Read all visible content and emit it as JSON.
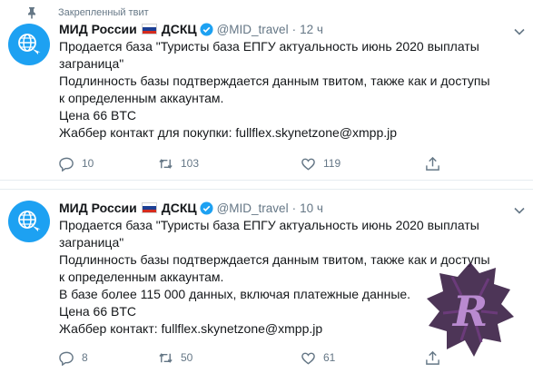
{
  "pinned_label": "Закрепленный твит",
  "tweets": [
    {
      "name": "МИД России",
      "org": "ДСКЦ",
      "handle": "@MID_travel",
      "time": "12 ч",
      "lines": [
        "Продается база \"Туристы база ЕПГУ актуальность июнь 2020 выплаты",
        "заграница\"",
        "Подлинность базы подтверждается данным твитом, также как и доступы",
        "к определенным аккаунтам.",
        "Цена 66 BTC",
        "Жаббер контакт для покупки:  fullflex.skynetzone@xmpp.jp"
      ],
      "replies": "10",
      "retweets": "103",
      "likes": "119"
    },
    {
      "name": "МИД России",
      "org": "ДСКЦ",
      "handle": "@MID_travel",
      "time": "10 ч",
      "lines": [
        "Продается база \"Туристы база ЕПГУ актуальность июнь 2020 выплаты",
        "заграница\"",
        "Подлинность базы подтверждается данным твитом, также как и доступы",
        "к определенным аккаунтам.",
        "В базе более 115 000 данных, включая платежные данные.",
        "Цена 66 BTC",
        "Жаббер контакт:  fullflex.skynetzone@xmpp.jp"
      ],
      "replies": "8",
      "retweets": "50",
      "likes": "61"
    }
  ],
  "watermark_letter": "R",
  "colors": {
    "accent": "#1da1f2",
    "secondary_text": "#657786",
    "text": "#14171a",
    "flag_white": "#ffffff",
    "flag_blue": "#1c3f94",
    "flag_red": "#d52b1e"
  },
  "icons": [
    "pin-icon",
    "globe-icon",
    "verified-icon",
    "chevron-down-icon",
    "reply-icon",
    "retweet-icon",
    "like-icon",
    "share-icon",
    "watermark-logo"
  ]
}
